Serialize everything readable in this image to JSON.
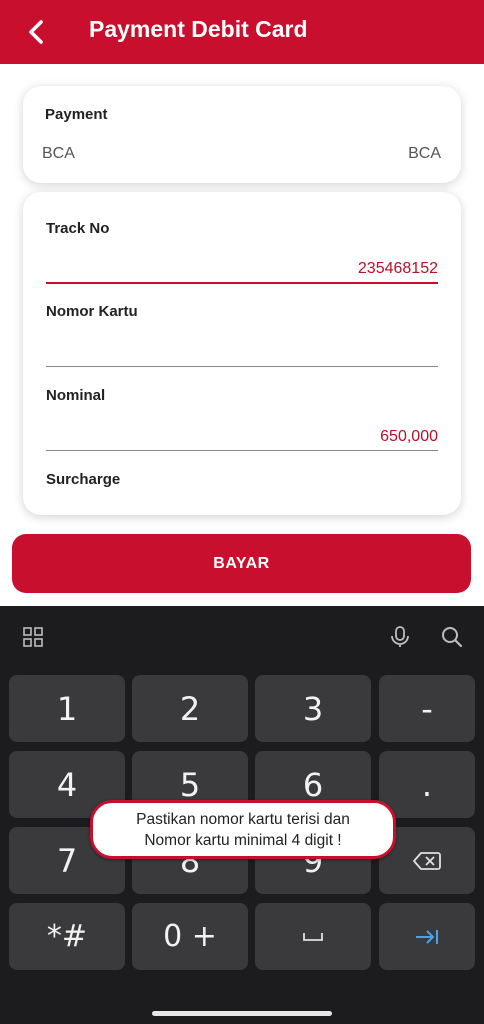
{
  "header": {
    "title": "Payment Debit Card",
    "back_icon": "chevron-left-icon"
  },
  "payment_card": {
    "label": "Payment",
    "left_value": "BCA",
    "right_value": "BCA"
  },
  "form": {
    "track_no": {
      "label": "Track No",
      "value": "235468152"
    },
    "nomor_kartu": {
      "label": "Nomor Kartu",
      "value": ""
    },
    "nominal": {
      "label": "Nominal",
      "value": "650,000"
    },
    "surcharge": {
      "label": "Surcharge"
    }
  },
  "pay_button": {
    "label": "BAYAR"
  },
  "keyboard": {
    "toolbar": {
      "apps_icon": "grid-icon",
      "mic_icon": "mic-icon",
      "search_icon": "search-icon"
    },
    "keys": [
      "1",
      "2",
      "3",
      "-",
      "4",
      "5",
      "6",
      ".",
      "7",
      "8",
      "9",
      "backspace",
      "*#",
      "0 +",
      "space",
      "tab"
    ]
  },
  "toast": {
    "line1": "Pastikan nomor kartu terisi dan",
    "line2": "Nomor kartu minimal 4 digit !"
  },
  "colors": {
    "primary": "#c8102e",
    "keyboard_bg": "#1c1c1e",
    "key_bg": "#3a3a3c"
  }
}
